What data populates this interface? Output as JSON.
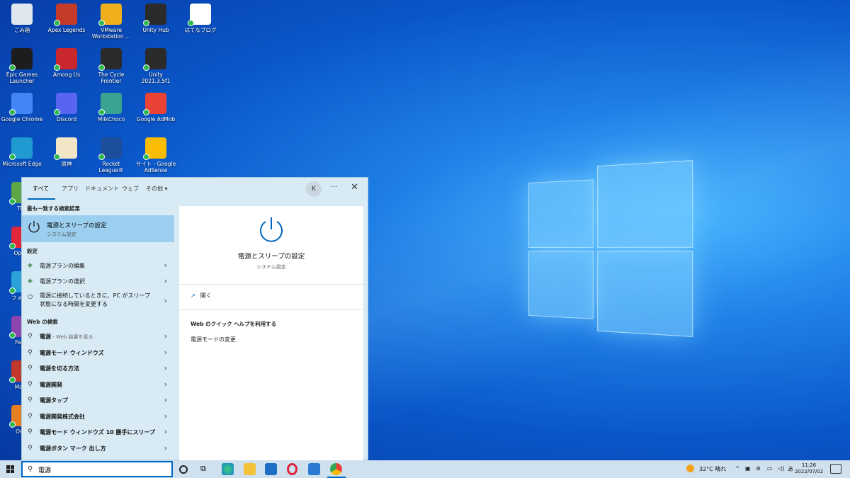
{
  "desktop": {
    "icons": [
      {
        "label": "ごみ箱",
        "color": "#dfe8ef"
      },
      {
        "label": "Apex Legends",
        "color": "#c53b2b"
      },
      {
        "label": "VMware Workstation ...",
        "color": "#f0b01e"
      },
      {
        "label": "Unity Hub",
        "color": "#2b2b2b"
      },
      {
        "label": "はてなブログ",
        "color": "#ffffff"
      },
      {
        "label": "Epic Games Launcher",
        "color": "#1d1d1d"
      },
      {
        "label": "Among Us",
        "color": "#c8282d"
      },
      {
        "label": "The Cycle Frontier",
        "color": "#2a2a2a"
      },
      {
        "label": "Unity 2021.3.5f1",
        "color": "#2b2b2b"
      },
      {
        "label": "Google Chrome",
        "color": "#4285f4"
      },
      {
        "label": "Discord",
        "color": "#5865f2"
      },
      {
        "label": "MilkChoco",
        "color": "#3aa38f"
      },
      {
        "label": "Google AdMob",
        "color": "#ea4335"
      },
      {
        "label": "Microsoft Edge",
        "color": "#1f9bd1"
      },
      {
        "label": "原神",
        "color": "#f3e6c7"
      },
      {
        "label": "Rocket League®",
        "color": "#1c4e9c"
      },
      {
        "label": "サイト - Google AdSense",
        "color": "#fbbc04"
      },
      {
        "label": "Tl...",
        "color": "#5ea547"
      },
      {
        "label": "Opera",
        "color": "#e0263b"
      },
      {
        "label": "フォー...",
        "color": "#2aa1d8"
      },
      {
        "label": "Fall...",
        "color": "#8e44ad"
      },
      {
        "label": "Mar...",
        "color": "#c0392b"
      },
      {
        "label": "On...",
        "color": "#e67e22"
      }
    ]
  },
  "search_menu": {
    "tabs": [
      "すべて",
      "アプリ",
      "ドキュメント",
      "ウェブ",
      "その他 ▾"
    ],
    "avatar_initial": "K",
    "more_label": "···",
    "close_label": "✕",
    "best_match_header": "最も一致する検索結果",
    "best_match": {
      "title": "電源とスリープの設定",
      "subtitle": "システム設定"
    },
    "settings_header": "設定",
    "settings_items": [
      {
        "label": "電源プランの編集"
      },
      {
        "label": "電源プランの選択"
      },
      {
        "label": "電源に接続しているときに、PC がスリープ",
        "label2": "状態になる時間を変更する"
      }
    ],
    "web_header": "Web の検索",
    "web_items": [
      {
        "label": "電源",
        "sub": " - Web 結果を見る"
      },
      {
        "label": "電源モード ウィンドウズ"
      },
      {
        "label": "電源を切る方法"
      },
      {
        "label": "電源開発"
      },
      {
        "label": "電源タップ"
      },
      {
        "label": "電源開発株式会社"
      },
      {
        "label": "電源モード ウィンドウズ 10 勝手にスリープ"
      },
      {
        "label": "電源ボタン マーク 出し方"
      }
    ],
    "preview": {
      "title": "電源とスリープの設定",
      "subtitle": "システム設定",
      "open_label": "開く",
      "web_help": "Web のクイック ヘルプを利用する",
      "link": "電源モードの変更"
    }
  },
  "taskbar": {
    "search_value": "電源",
    "weather": "32°C 晴れ",
    "ime": "あ",
    "time": "11:26",
    "date": "2022/07/02"
  },
  "colors": {
    "accent": "#0067c0",
    "selected": "#9ccfef"
  }
}
